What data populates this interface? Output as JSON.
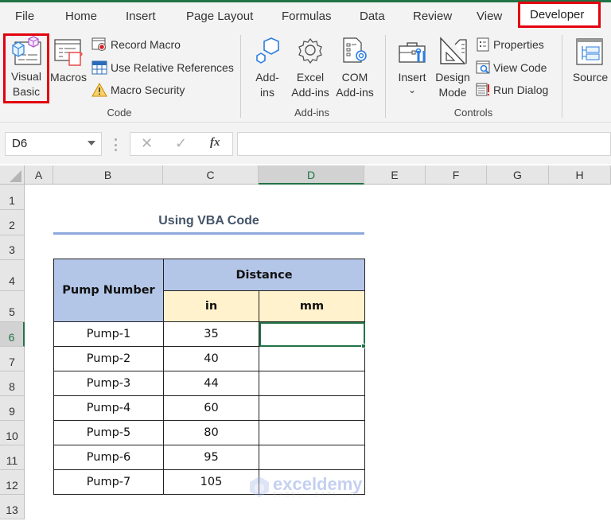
{
  "ribbon": {
    "tabs": [
      "File",
      "Home",
      "Insert",
      "Page Layout",
      "Formulas",
      "Data",
      "Review",
      "View",
      "Developer"
    ],
    "active_tab": "Developer",
    "groups": {
      "code": {
        "label": "Code",
        "visual_basic": [
          "Visual",
          "Basic"
        ],
        "macros": "Macros",
        "record_macro": "Record Macro",
        "use_relative_references": "Use Relative References",
        "macro_security": "Macro Security"
      },
      "addins": {
        "label": "Add-ins",
        "add_ins": [
          "Add-",
          "ins"
        ],
        "excel_add_ins": [
          "Excel",
          "Add-ins"
        ],
        "com_add_ins": [
          "COM",
          "Add-ins"
        ]
      },
      "controls": {
        "label": "Controls",
        "insert": "Insert",
        "insert_caret": "⌄",
        "design_mode": [
          "Design",
          "Mode"
        ],
        "properties": "Properties",
        "view_code": "View Code",
        "run_dialog": "Run Dialog"
      },
      "xml": {
        "source": "Source"
      }
    }
  },
  "formula_bar": {
    "name_box": "D6",
    "cancel_icon": "✕",
    "enter_icon": "✓",
    "fx_label": "fx",
    "formula": ""
  },
  "grid": {
    "columns": [
      "A",
      "B",
      "C",
      "D",
      "E",
      "F",
      "G",
      "H"
    ],
    "selected_column": "D",
    "rows": [
      "1",
      "2",
      "3",
      "4",
      "5",
      "6",
      "7",
      "8",
      "9",
      "10",
      "11",
      "12",
      "13"
    ],
    "selected_row": "6",
    "active_cell": "D6"
  },
  "sheet": {
    "title": "Using VBA Code",
    "table": {
      "header_pump": "Pump Number",
      "header_distance": "Distance",
      "header_in": "in",
      "header_mm": "mm",
      "rows": [
        {
          "pump": "Pump-1",
          "in": "35",
          "mm": ""
        },
        {
          "pump": "Pump-2",
          "in": "40",
          "mm": ""
        },
        {
          "pump": "Pump-3",
          "in": "44",
          "mm": ""
        },
        {
          "pump": "Pump-4",
          "in": "60",
          "mm": ""
        },
        {
          "pump": "Pump-5",
          "in": "80",
          "mm": ""
        },
        {
          "pump": "Pump-6",
          "in": "95",
          "mm": ""
        },
        {
          "pump": "Pump-7",
          "in": "105",
          "mm": ""
        }
      ]
    }
  },
  "watermark": {
    "name": "exceldemy",
    "tagline": "EXCEL · DATA · BI"
  },
  "colors": {
    "excel_green": "#217346",
    "highlight_red": "#e3000f",
    "header_blue": "#b4c6e7",
    "header_yellow": "#fff2cc",
    "title_text": "#44546a",
    "title_underline": "#8ea9db"
  }
}
